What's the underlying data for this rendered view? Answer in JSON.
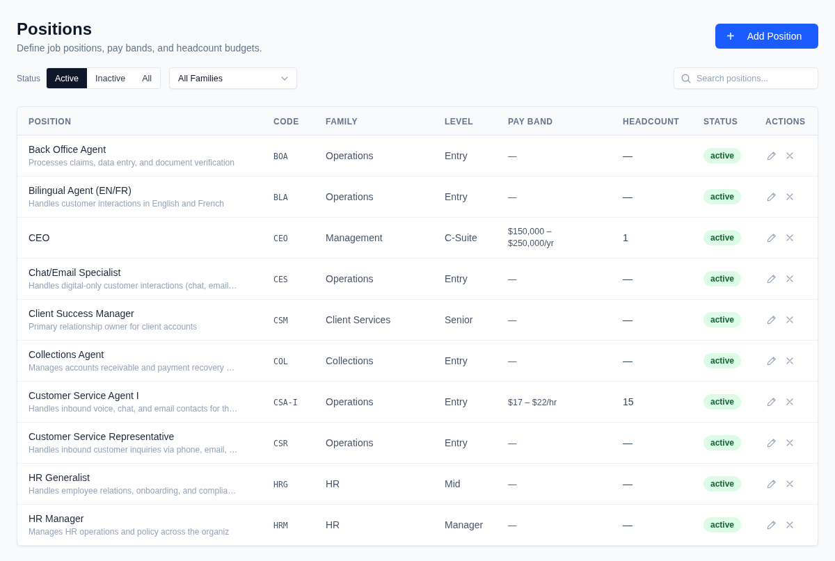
{
  "header": {
    "title": "Positions",
    "subtitle": "Define job positions, pay bands, and headcount budgets.",
    "add_button": {
      "icon": "+",
      "label": "Add Position"
    }
  },
  "filters": {
    "status_label": "Status",
    "status_segments": [
      {
        "label": "Active",
        "selected": true
      },
      {
        "label": "Inactive",
        "selected": false
      },
      {
        "label": "All",
        "selected": false
      }
    ],
    "family_select": {
      "value": "All Families"
    },
    "search": {
      "placeholder": "Search positions..."
    }
  },
  "table": {
    "columns": [
      "POSITION",
      "CODE",
      "FAMILY",
      "LEVEL",
      "PAY BAND",
      "HEADCOUNT",
      "STATUS",
      "ACTIONS"
    ],
    "rows": [
      {
        "position": "Back Office Agent",
        "description": "Processes claims, data entry, and document verification",
        "code": "BOA",
        "family": "Operations",
        "level": "Entry",
        "pay_band": "—",
        "headcount": "—",
        "status": "active"
      },
      {
        "position": "Bilingual Agent (EN/FR)",
        "description": "Handles customer interactions in English and French",
        "code": "BLA",
        "family": "Operations",
        "level": "Entry",
        "pay_band": "—",
        "headcount": "—",
        "status": "active"
      },
      {
        "position": "CEO",
        "code": "CEO",
        "family": "Management",
        "level": "C-Suite",
        "pay_band": "$150,000 – $250,000/yr",
        "headcount": "1",
        "status": "active"
      },
      {
        "position": "Chat/Email Specialist",
        "description": "Handles digital-only customer interactions (chat, email…",
        "code": "CES",
        "family": "Operations",
        "level": "Entry",
        "pay_band": "—",
        "headcount": "—",
        "status": "active"
      },
      {
        "position": "Client Success Manager",
        "description": "Primary relationship owner for client accounts",
        "code": "CSM",
        "family": "Client Services",
        "level": "Senior",
        "pay_band": "—",
        "headcount": "—",
        "status": "active"
      },
      {
        "position": "Collections Agent",
        "description": "Manages accounts receivable and payment recovery …",
        "code": "COL",
        "family": "Collections",
        "level": "Entry",
        "pay_band": "—",
        "headcount": "—",
        "status": "active"
      },
      {
        "position": "Customer Service Agent I",
        "description": "Handles inbound voice, chat, and email contacts for th…",
        "code": "CSA-I",
        "family": "Operations",
        "level": "Entry",
        "pay_band": "$17 – $22/hr",
        "headcount": "15",
        "status": "active"
      },
      {
        "position": "Customer Service Representative",
        "description": "Handles inbound customer inquiries via phone, email, …",
        "code": "CSR",
        "family": "Operations",
        "level": "Entry",
        "pay_band": "—",
        "headcount": "—",
        "status": "active"
      },
      {
        "position": "HR Generalist",
        "description": "Handles employee relations, onboarding, and complia…",
        "code": "HRG",
        "family": "HR",
        "level": "Mid",
        "pay_band": "—",
        "headcount": "—",
        "status": "active"
      },
      {
        "position": "HR Manager",
        "description": "Manages HR operations and policy across the organiz",
        "code": "HRM",
        "family": "HR",
        "level": "Manager",
        "pay_band": "—",
        "headcount": "—",
        "status": "active"
      }
    ]
  }
}
